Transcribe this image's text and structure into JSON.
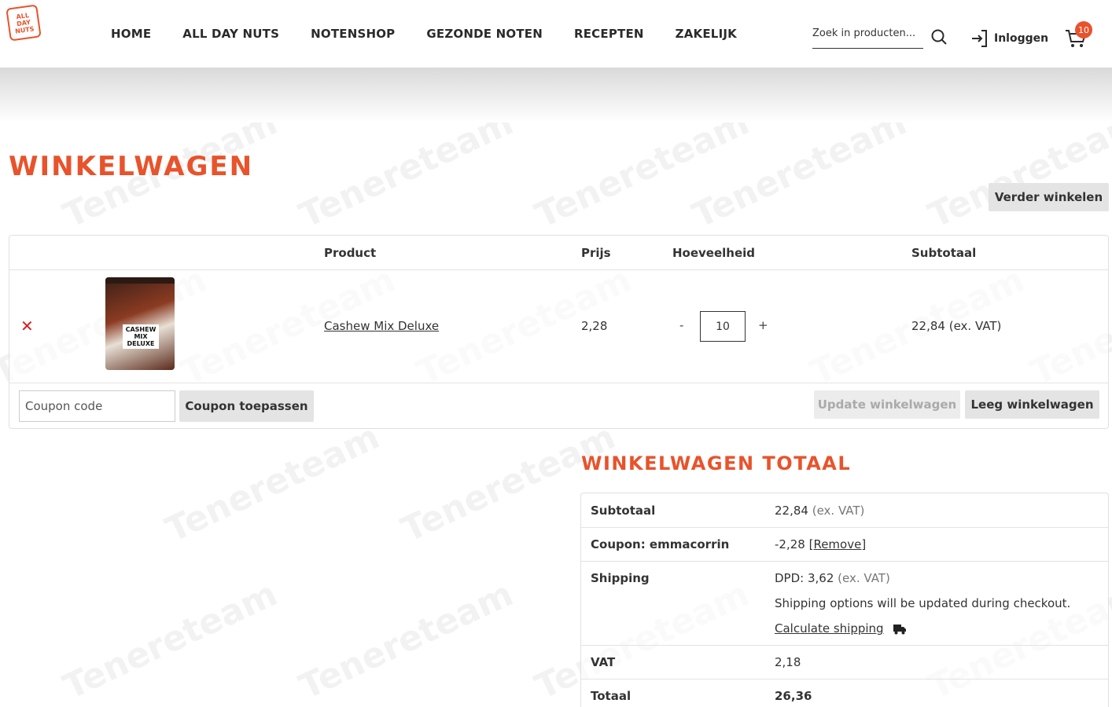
{
  "brand": {
    "logo_lines": [
      "ALL",
      "DAY",
      "NUTS"
    ],
    "accent_color": "#e8532c"
  },
  "nav": {
    "items": [
      "HOME",
      "ALL DAY NUTS",
      "NOTENSHOP",
      "GEZONDE NOTEN",
      "RECEPTEN",
      "ZAKELIJK"
    ]
  },
  "header": {
    "search_placeholder": "Zoek in producten...",
    "login_label": "Inloggen",
    "cart_count": "10",
    "icons": [
      "search-icon",
      "login-icon",
      "cart-icon"
    ]
  },
  "watermark": {
    "text": "Tenereteam"
  },
  "page": {
    "title": "WINKELWAGEN",
    "continue_shopping": "Verder winkelen"
  },
  "cart": {
    "headers": {
      "product": "Product",
      "price": "Prijs",
      "quantity": "Hoeveelheid",
      "subtotal": "Subtotaal"
    },
    "items": [
      {
        "remove_symbol": "✕",
        "image_label": "CASHEW MIX DELUXE",
        "image_top_text": "EERLIJK • HEERLIJK",
        "image_brand": "ALL DAY NUTS",
        "name": "Cashew Mix Deluxe",
        "price": "2,28",
        "quantity_minus": "-",
        "quantity": "10",
        "quantity_plus": "+",
        "subtotal": "22,84",
        "subtotal_suffix": "(ex. VAT)"
      }
    ],
    "coupon_placeholder": "Coupon code",
    "apply_coupon": "Coupon toepassen",
    "update_cart": "Update winkelwagen",
    "empty_cart": "Leeg winkelwagen"
  },
  "totals": {
    "title": "WINKELWAGEN TOTAAL",
    "subtotal_label": "Subtotaal",
    "subtotal_value": "22,84",
    "subtotal_suffix": "(ex. VAT)",
    "coupon_label": "Coupon: emmacorrin",
    "coupon_value": "-2,28",
    "coupon_remove": "[Remove]",
    "shipping_label": "Shipping",
    "shipping_method": "DPD: 3,62",
    "shipping_suffix": "(ex. VAT)",
    "shipping_note": "Shipping options will be updated during checkout.",
    "calculate_shipping": "Calculate shipping",
    "vat_label": "VAT",
    "vat_value": "2,18",
    "total_label": "Totaal",
    "total_value": "26,36"
  }
}
